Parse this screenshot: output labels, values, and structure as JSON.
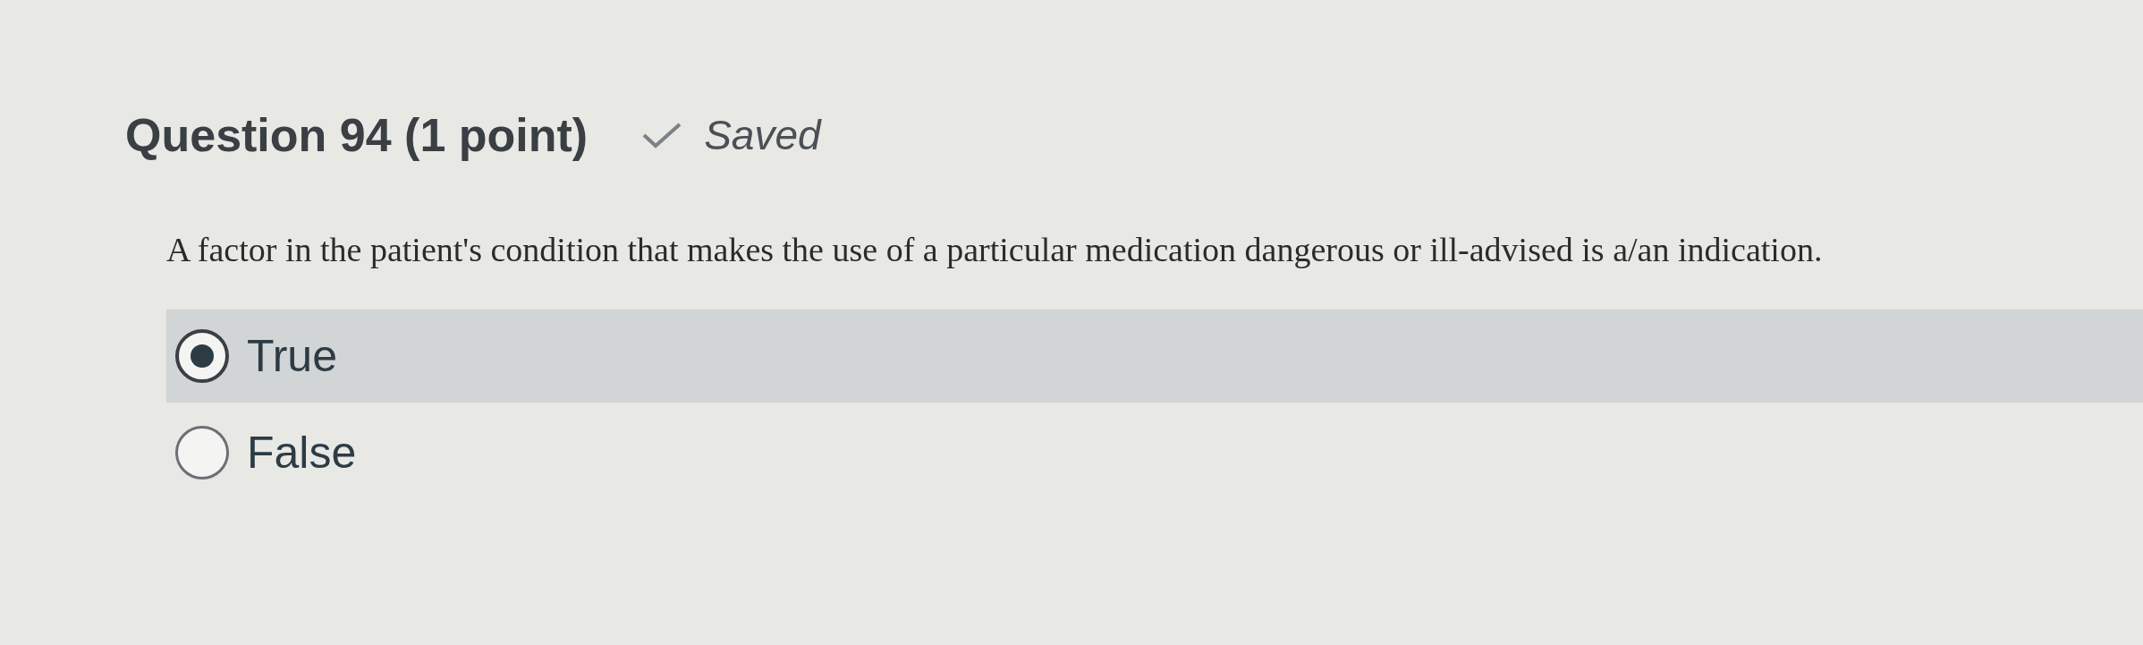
{
  "question": {
    "title": "Question 94 (1 point)",
    "status": "Saved",
    "text": "A factor in the patient's condition that makes the use of a particular medication dangerous or ill-advised is a/an indication."
  },
  "options": [
    {
      "label": "True",
      "selected": true
    },
    {
      "label": "False",
      "selected": false
    }
  ]
}
